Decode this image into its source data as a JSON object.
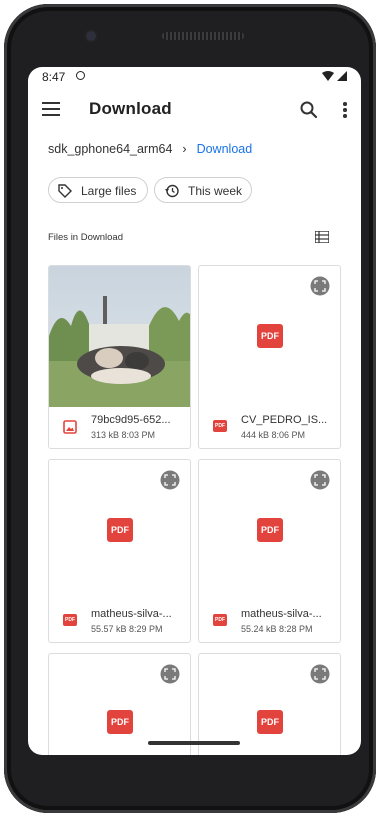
{
  "status": {
    "time": "8:47"
  },
  "appbar": {
    "title": "Download"
  },
  "breadcrumb": {
    "root": "sdk_gphone64_arm64",
    "current": "Download"
  },
  "chips": [
    {
      "label": "Large files",
      "icon": "tag-icon"
    },
    {
      "label": "This week",
      "icon": "history-icon"
    }
  ],
  "section": {
    "title": "Files in Download"
  },
  "files": [
    {
      "name": "79bc9d95-652...",
      "meta": "313 kB 8:03 PM",
      "type": "image"
    },
    {
      "name": "CV_PEDRO_IS...",
      "meta": "444 kB 8:06 PM",
      "type": "pdf"
    },
    {
      "name": "matheus-silva-...",
      "meta": "55.57 kB 8:29 PM",
      "type": "pdf"
    },
    {
      "name": "matheus-silva-...",
      "meta": "55.24 kB 8:28 PM",
      "type": "pdf"
    },
    {
      "name": "",
      "meta": "",
      "type": "pdf"
    },
    {
      "name": "",
      "meta": "",
      "type": "pdf"
    }
  ],
  "labels": {
    "pdf": "PDF",
    "pdf_small": "PDF"
  },
  "colors": {
    "accent": "#1a73e8",
    "pdf": "#e2443d"
  }
}
